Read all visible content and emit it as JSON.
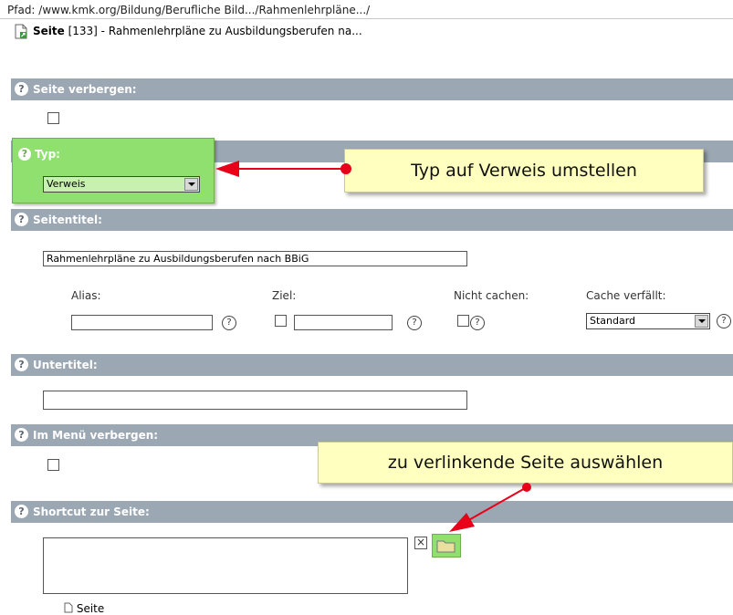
{
  "path": "Pfad: /www.kmk.org/Bildung/Berufliche Bild.../Rahmenlehrpläne.../",
  "page": {
    "label": "Seite",
    "rest": " [133] - Rahmenlehrpläne zu Ausbildungsberufen na..."
  },
  "sections": {
    "hide_page": "Seite verbergen:",
    "type": "Typ:",
    "page_title": "Seitentitel:",
    "subtitle": "Untertitel:",
    "hide_menu": "Im Menü verbergen:",
    "shortcut": "Shortcut zur Seite:"
  },
  "help_glyph": "?",
  "type_select": {
    "value": "Verweis"
  },
  "page_title_value": "Rahmenlehrpläne zu Ausbildungsberufen nach BBiG",
  "fields": {
    "alias": "Alias:",
    "target": "Ziel:",
    "no_cache": "Nicht cachen:",
    "cache_expires": "Cache verfällt:",
    "cache_value": "Standard"
  },
  "subtitle_value": "",
  "shortcut_clear": "×",
  "shortcut_page_link": "Seite",
  "callouts": {
    "type_hint": "Typ auf Verweis umstellen",
    "link_hint": "zu verlinkende Seite auswählen"
  },
  "colors": {
    "section_bar": "#9ba7b2",
    "highlight": "#90e070",
    "callout": "#ffffbf",
    "arrow": "#e8001a"
  }
}
